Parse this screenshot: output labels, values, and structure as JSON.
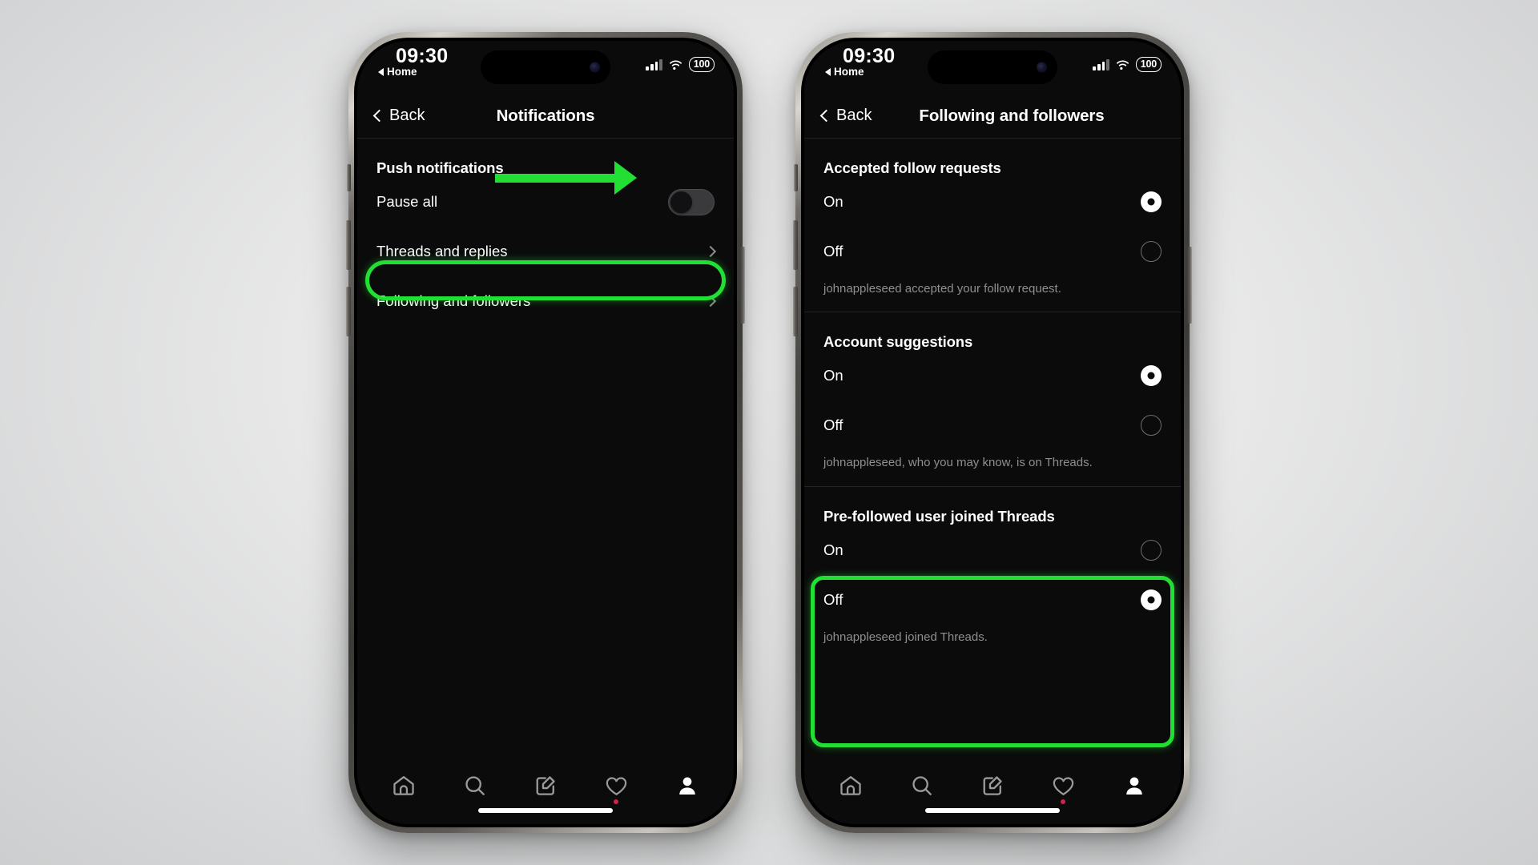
{
  "status_bar": {
    "time": "09:30",
    "home_indicator_label": "Home",
    "battery": "100",
    "icons": [
      "triangle-left-icon",
      "cellular-signal-icon",
      "wifi-icon",
      "battery-icon"
    ]
  },
  "phones": [
    {
      "id": "left",
      "nav": {
        "back_label": "Back",
        "title": "Notifications"
      },
      "section_title": "Push notifications",
      "rows": [
        {
          "label": "Pause all",
          "control": "toggle",
          "toggle_state": "off"
        },
        {
          "label": "Threads and replies",
          "control": "chevron"
        },
        {
          "label": "Following and followers",
          "control": "chevron",
          "highlighted": true
        }
      ],
      "annotations": {
        "arrow": {
          "color": "#22e033",
          "points_to": "Pause all toggle"
        },
        "highlight_box": {
          "color": "#22e033",
          "target": "Following and followers"
        }
      }
    },
    {
      "id": "right",
      "nav": {
        "back_label": "Back",
        "title": "Following and followers"
      },
      "sections": [
        {
          "title": "Accepted follow requests",
          "options": [
            {
              "label": "On",
              "selected": true
            },
            {
              "label": "Off",
              "selected": false
            }
          ],
          "caption": "johnappleseed accepted your follow request.",
          "highlighted": false
        },
        {
          "title": "Account suggestions",
          "options": [
            {
              "label": "On",
              "selected": true
            },
            {
              "label": "Off",
              "selected": false
            }
          ],
          "caption": "johnappleseed, who you may know, is on Threads.",
          "highlighted": false
        },
        {
          "title": "Pre-followed user joined Threads",
          "options": [
            {
              "label": "On",
              "selected": false
            },
            {
              "label": "Off",
              "selected": true
            }
          ],
          "caption": "johnappleseed joined Threads.",
          "highlighted": true
        }
      ],
      "annotations": {
        "highlight_box": {
          "color": "#22e033",
          "target": "Pre-followed user joined Threads"
        }
      }
    }
  ],
  "tabbar": {
    "items": [
      {
        "icon": "home-icon",
        "active": false,
        "badge": false
      },
      {
        "icon": "search-icon",
        "active": false,
        "badge": false
      },
      {
        "icon": "compose-icon",
        "active": false,
        "badge": false
      },
      {
        "icon": "heart-icon",
        "active": false,
        "badge": true
      },
      {
        "icon": "profile-icon",
        "active": true,
        "badge": false
      }
    ]
  },
  "colors": {
    "accent_green": "#22e033",
    "screen_bg": "#0b0b0b",
    "text_primary": "#ffffff",
    "text_secondary": "#8f8f8f",
    "divider": "#232323",
    "badge_red": "#d7204a"
  }
}
